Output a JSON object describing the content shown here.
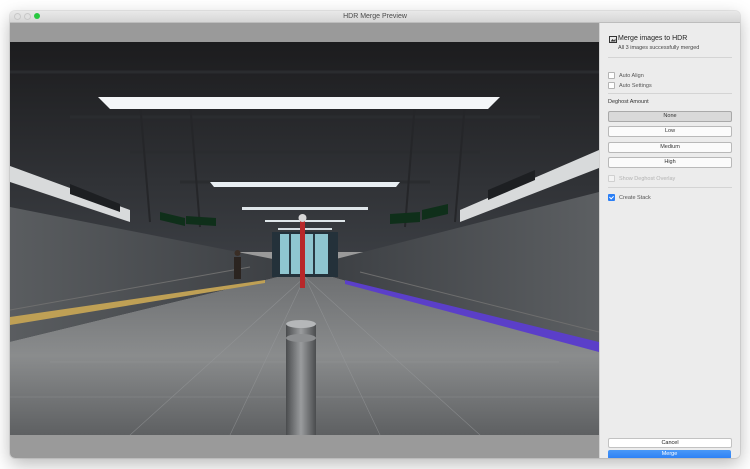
{
  "window": {
    "title": "HDR Merge Preview"
  },
  "panel": {
    "heading": "Merge images to HDR",
    "status": "All 3 images successfully merged",
    "options": {
      "auto_align": {
        "label": "Auto Align",
        "checked": false
      },
      "auto_settings": {
        "label": "Auto Settings",
        "checked": false
      }
    },
    "deghost": {
      "label": "Deghost Amount",
      "levels": [
        "None",
        "Low",
        "Medium",
        "High"
      ],
      "selected": "None",
      "overlay": {
        "label": "Show Deghost Overlay",
        "checked": false,
        "enabled": false
      }
    },
    "create_stack": {
      "label": "Create Stack",
      "checked": true
    },
    "cancel_label": "Cancel",
    "merge_label": "Merge"
  },
  "colors": {
    "accent": "#2b7ff6",
    "panel_bg": "#ececec",
    "preview_bg": "#9a9a9a"
  },
  "image": {
    "subject": "subway station platform HDR preview"
  }
}
